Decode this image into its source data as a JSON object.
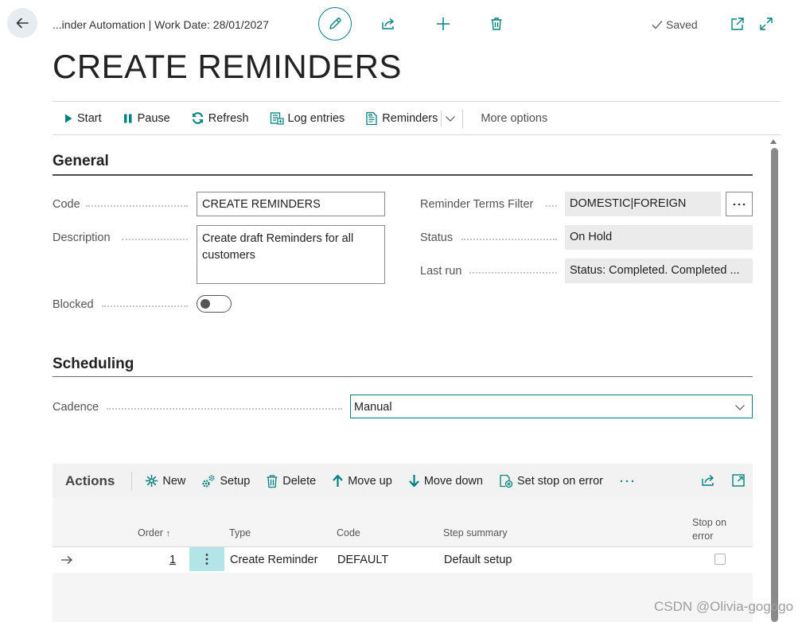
{
  "header": {
    "breadcrumb": "...inder Automation | Work Date: 28/01/2027",
    "saved_label": "Saved",
    "icons": [
      "back-arrow-icon",
      "pencil-icon",
      "share-icon",
      "plus-icon",
      "trash-icon",
      "check-icon",
      "open-new-window-icon",
      "expand-icon"
    ]
  },
  "page": {
    "title": "CREATE REMINDERS"
  },
  "actionbar": {
    "start": "Start",
    "pause": "Pause",
    "refresh": "Refresh",
    "log_entries": "Log entries",
    "reminders": "Reminders",
    "more_options": "More options"
  },
  "general": {
    "title": "General",
    "code_label": "Code",
    "code_value": "CREATE REMINDERS",
    "description_label": "Description",
    "description_value": "Create draft Reminders for all customers",
    "blocked_label": "Blocked",
    "blocked_value": false,
    "terms_filter_label": "Reminder Terms Filter",
    "terms_filter_value": "DOMESTIC|FOREIGN",
    "status_label": "Status",
    "status_value": "On Hold",
    "last_run_label": "Last run",
    "last_run_value": "Status: Completed. Completed ..."
  },
  "scheduling": {
    "title": "Scheduling",
    "cadence_label": "Cadence",
    "cadence_value": "Manual"
  },
  "actions": {
    "title": "Actions",
    "toolbar": {
      "new": "New",
      "setup": "Setup",
      "delete": "Delete",
      "move_up": "Move up",
      "move_down": "Move down",
      "set_stop_on_error": "Set stop on error"
    },
    "columns": {
      "order": "Order",
      "type": "Type",
      "code": "Code",
      "step_summary": "Step summary",
      "stop_on_error_line1": "Stop on",
      "stop_on_error_line2": "error"
    },
    "rows": [
      {
        "order": "1",
        "type": "Create Reminder",
        "code": "DEFAULT",
        "step_summary": "Default setup",
        "stop_on_error": false
      }
    ]
  },
  "watermark": "CSDN @Olivia-gogogo",
  "colors": {
    "accent": "#00827F",
    "row_highlight": "#b2e4e8",
    "readonly_bg": "#ebebeb",
    "subpage_bg": "#f2f2f2"
  }
}
